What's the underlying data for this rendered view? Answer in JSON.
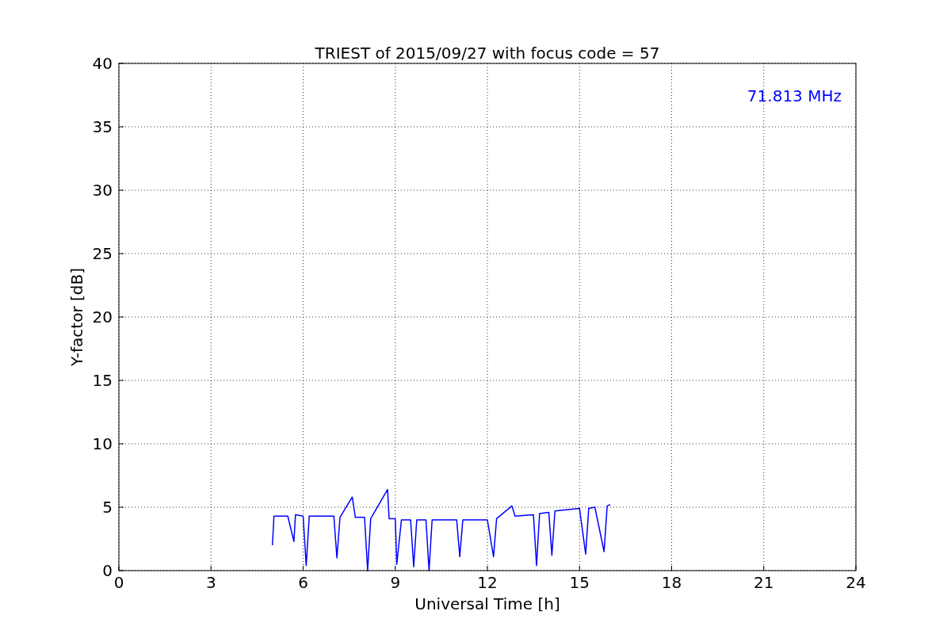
{
  "chart_data": {
    "type": "line",
    "title": "TRIEST of 2015/09/27 with focus code = 57",
    "xlabel": "Universal Time [h]",
    "ylabel": "Y-factor [dB]",
    "x": [
      5.0,
      5.05,
      5.5,
      5.7,
      5.75,
      6.0,
      6.1,
      6.2,
      6.5,
      7.0,
      7.1,
      7.2,
      7.6,
      7.7,
      8.0,
      8.1,
      8.2,
      8.75,
      8.8,
      9.0,
      9.05,
      9.2,
      9.5,
      9.6,
      9.7,
      10.0,
      10.1,
      10.2,
      10.5,
      11.0,
      11.1,
      11.2,
      12.0,
      12.2,
      12.3,
      12.8,
      12.9,
      13.5,
      13.6,
      13.7,
      14.0,
      14.1,
      14.2,
      15.0,
      15.2,
      15.3,
      15.5,
      15.8,
      15.9,
      16.0
    ],
    "series": [
      {
        "name": "71.813 MHz",
        "color": "#0000ff",
        "values": [
          2.0,
          4.3,
          4.3,
          2.3,
          4.4,
          4.3,
          0.4,
          4.3,
          4.3,
          4.3,
          1.0,
          4.2,
          5.8,
          4.2,
          4.2,
          0.0,
          4.1,
          6.4,
          4.1,
          4.1,
          0.5,
          4.0,
          4.0,
          0.3,
          4.0,
          4.0,
          0.0,
          4.0,
          4.0,
          4.0,
          1.1,
          4.0,
          4.0,
          1.1,
          4.1,
          5.1,
          4.3,
          4.4,
          0.4,
          4.5,
          4.6,
          1.2,
          4.7,
          4.9,
          1.3,
          4.9,
          5.0,
          1.5,
          5.1,
          5.2
        ]
      }
    ],
    "xlim": [
      0,
      24
    ],
    "ylim": [
      0,
      40
    ],
    "xticks": [
      0,
      3,
      6,
      9,
      12,
      15,
      18,
      21,
      24
    ],
    "yticks": [
      0,
      5,
      10,
      15,
      20,
      25,
      30,
      35,
      40
    ],
    "grid": true
  }
}
